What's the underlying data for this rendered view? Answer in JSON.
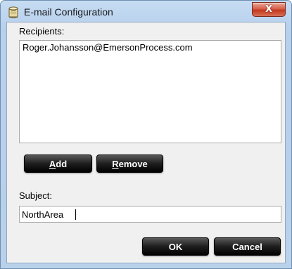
{
  "window": {
    "title": "E-mail Configuration",
    "close_glyph": "X",
    "icon": "database-icon"
  },
  "recipients": {
    "label": "Recipients:",
    "items": [
      "Roger.Johansson@EmersonProcess.com"
    ]
  },
  "buttons": {
    "add": {
      "mnemonic": "A",
      "rest": "dd"
    },
    "remove": {
      "mnemonic": "R",
      "rest": "emove"
    },
    "ok": "OK",
    "cancel": "Cancel"
  },
  "subject": {
    "label": "Subject:",
    "value": "NorthArea"
  },
  "colors": {
    "title_bar": "#b9d1ea",
    "close_button": "#c3381f",
    "button_black": "#000000",
    "dialog_body": "#f0f0f0"
  }
}
